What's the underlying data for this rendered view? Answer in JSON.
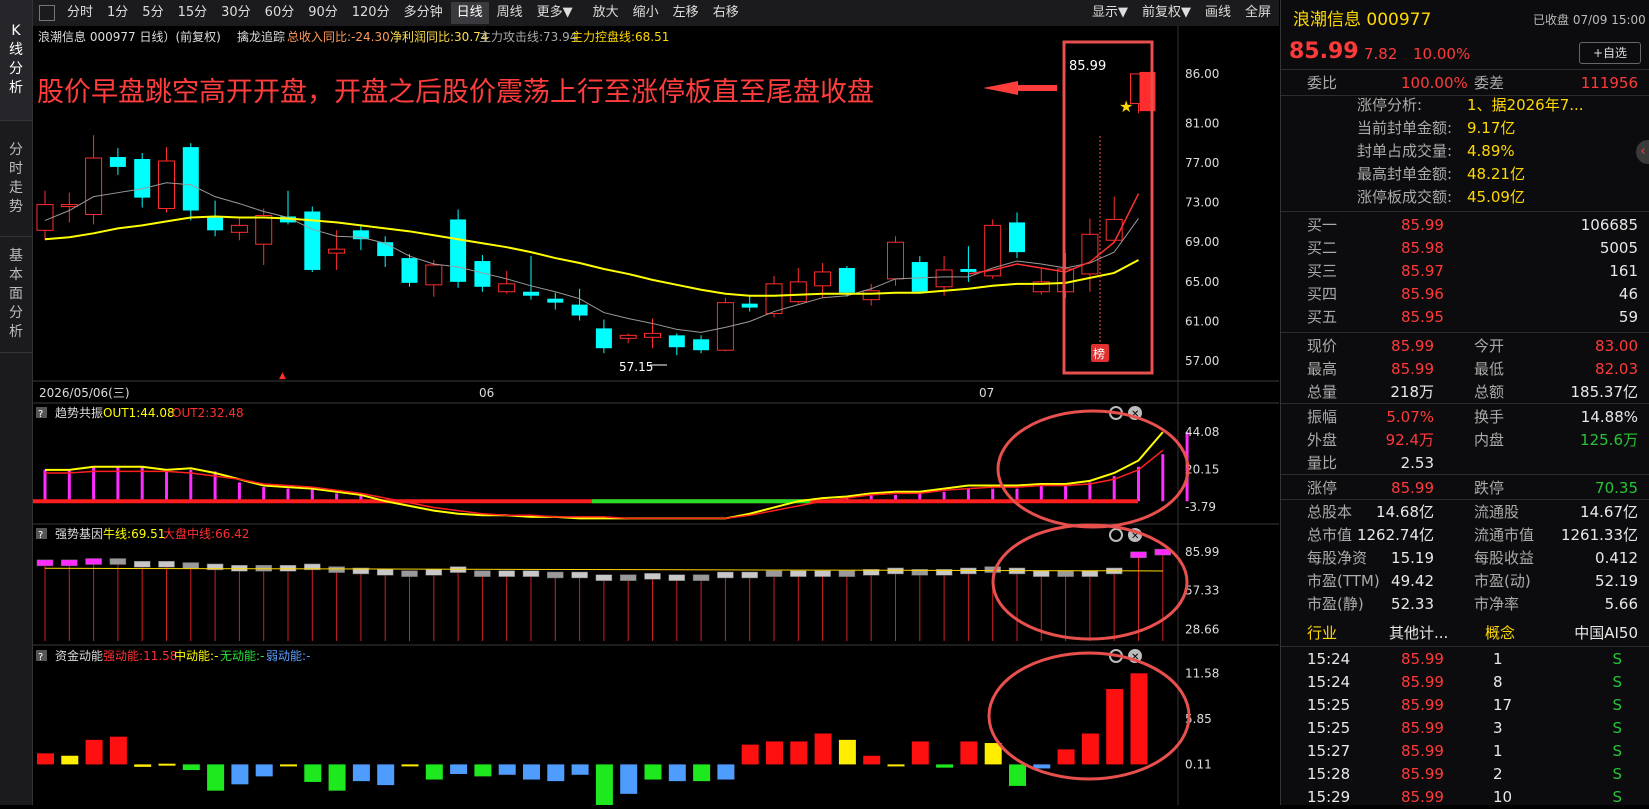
{
  "left_tabs": [
    "K线分析",
    "分时走势",
    "基本面分析"
  ],
  "toolbar": {
    "periods": [
      "分时",
      "1分",
      "5分",
      "15分",
      "30分",
      "60分",
      "90分",
      "120分",
      "多分钟",
      "日线",
      "周线",
      "更多▼"
    ],
    "active_period": "日线",
    "actions": [
      "放大",
      "缩小",
      "左移",
      "右移"
    ],
    "right": [
      "显示▼",
      "前复权▼",
      "画线",
      "全屏"
    ]
  },
  "chart_header": {
    "stock": "浪潮信息 000977 日线）(前复权)",
    "indicator": "擒龙追踪",
    "revenue": "总收入同比:-24.30",
    "profit": "净利润同比:30.74",
    "attack": "主力攻击线:73.94",
    "control": "主力控盘线:68.51"
  },
  "annotation": "股价早盘跳空高开开盘，开盘之后股价震荡上行至涨停板直至尾盘收盘",
  "price_label": "85.99",
  "low_label": "57.15",
  "bang_label": "榜",
  "date_axis": [
    "2026/05/06(三)",
    "06",
    "07"
  ],
  "colors": {
    "up": "#ff2d2d",
    "down": "#00ffff",
    "ma_yellow": "#ffff00",
    "ma_gray": "#9a9a9a",
    "ma_red": "#ff3030",
    "annot_red": "#ff3d3d",
    "ring": "#e8504d"
  },
  "chart_data": [
    {
      "type": "candlestick",
      "title": "浪潮信息 000977 日线",
      "ylim": [
        56.0,
        88.0
      ],
      "y_ticks": [
        86.0,
        81.0,
        77.0,
        73.0,
        69.0,
        65.0,
        61.0,
        57.0
      ],
      "candles": [
        {
          "o": 70.2,
          "c": 72.8,
          "h": 74.2,
          "l": 69.2
        },
        {
          "o": 72.6,
          "c": 72.8,
          "h": 74.0,
          "l": 71.0
        },
        {
          "o": 71.8,
          "c": 77.5,
          "h": 79.8,
          "l": 70.8
        },
        {
          "o": 77.6,
          "c": 76.6,
          "h": 78.5,
          "l": 75.8
        },
        {
          "o": 77.4,
          "c": 73.5,
          "h": 78.0,
          "l": 72.5
        },
        {
          "o": 72.4,
          "c": 77.2,
          "h": 78.6,
          "l": 72.0
        },
        {
          "o": 78.6,
          "c": 72.2,
          "h": 79.0,
          "l": 71.2
        },
        {
          "o": 71.6,
          "c": 70.2,
          "h": 73.2,
          "l": 69.6
        },
        {
          "o": 70.0,
          "c": 70.7,
          "h": 71.6,
          "l": 69.2
        },
        {
          "o": 68.8,
          "c": 71.7,
          "h": 72.4,
          "l": 66.7
        },
        {
          "o": 71.6,
          "c": 71.0,
          "h": 74.2,
          "l": 70.8
        },
        {
          "o": 72.1,
          "c": 66.2,
          "h": 72.6,
          "l": 66.0
        },
        {
          "o": 67.9,
          "c": 68.3,
          "h": 70.2,
          "l": 66.2
        },
        {
          "o": 70.2,
          "c": 69.3,
          "h": 70.8,
          "l": 68.2
        },
        {
          "o": 69.0,
          "c": 67.6,
          "h": 69.6,
          "l": 66.5
        },
        {
          "o": 67.4,
          "c": 64.9,
          "h": 67.8,
          "l": 64.5
        },
        {
          "o": 64.7,
          "c": 66.7,
          "h": 67.2,
          "l": 63.5
        },
        {
          "o": 71.3,
          "c": 65.0,
          "h": 72.3,
          "l": 64.4
        },
        {
          "o": 67.1,
          "c": 64.5,
          "h": 67.7,
          "l": 64.0
        },
        {
          "o": 64.0,
          "c": 64.8,
          "h": 66.1,
          "l": 63.8
        },
        {
          "o": 64.0,
          "c": 63.6,
          "h": 67.6,
          "l": 63.2
        },
        {
          "o": 63.3,
          "c": 62.9,
          "h": 63.9,
          "l": 62.2
        },
        {
          "o": 62.7,
          "c": 61.6,
          "h": 64.3,
          "l": 61.1
        },
        {
          "o": 60.3,
          "c": 58.3,
          "h": 61.2,
          "l": 57.8
        },
        {
          "o": 59.3,
          "c": 59.6,
          "h": 59.8,
          "l": 58.8
        },
        {
          "o": 59.4,
          "c": 59.8,
          "h": 61.3,
          "l": 58.3
        },
        {
          "o": 59.6,
          "c": 58.4,
          "h": 59.8,
          "l": 57.6
        },
        {
          "o": 59.2,
          "c": 58.1,
          "h": 59.6,
          "l": 57.8
        },
        {
          "o": 58.1,
          "c": 62.9,
          "h": 63.4,
          "l": 58.0
        },
        {
          "o": 62.8,
          "c": 62.4,
          "h": 63.6,
          "l": 62.0
        },
        {
          "o": 61.8,
          "c": 64.8,
          "h": 65.6,
          "l": 61.4
        },
        {
          "o": 63.0,
          "c": 65.0,
          "h": 66.4,
          "l": 62.8
        },
        {
          "o": 64.6,
          "c": 66.0,
          "h": 66.9,
          "l": 63.4
        },
        {
          "o": 66.4,
          "c": 63.9,
          "h": 66.6,
          "l": 63.5
        },
        {
          "o": 63.2,
          "c": 64.1,
          "h": 64.8,
          "l": 62.6
        },
        {
          "o": 65.3,
          "c": 69.0,
          "h": 69.6,
          "l": 64.6
        },
        {
          "o": 67.0,
          "c": 64.0,
          "h": 67.6,
          "l": 63.8
        },
        {
          "o": 64.5,
          "c": 66.2,
          "h": 67.6,
          "l": 63.6
        },
        {
          "o": 66.3,
          "c": 66.0,
          "h": 68.6,
          "l": 65.0
        },
        {
          "o": 65.6,
          "c": 70.7,
          "h": 71.3,
          "l": 65.3
        },
        {
          "o": 71.0,
          "c": 68.0,
          "h": 72.0,
          "l": 67.4
        },
        {
          "o": 64.0,
          "c": 65.0,
          "h": 66.3,
          "l": 63.7
        },
        {
          "o": 64.0,
          "c": 66.3,
          "h": 67.9,
          "l": 63.4
        },
        {
          "o": 65.8,
          "c": 69.8,
          "h": 71.4,
          "l": 64.0
        },
        {
          "o": 69.2,
          "c": 71.3,
          "h": 73.6,
          "l": 69.0
        },
        {
          "o": 83.0,
          "c": 85.99,
          "h": 85.99,
          "l": 82.03
        }
      ],
      "ma_gray": [
        71.2,
        72.2,
        73.6,
        74.0,
        74.4,
        75.0,
        74.8,
        73.6,
        72.9,
        72.1,
        71.5,
        70.3,
        69.6,
        69.5,
        68.9,
        67.6,
        66.8,
        66.5,
        65.9,
        65.3,
        64.6,
        64.0,
        63.3,
        61.9,
        61.3,
        60.8,
        60.2,
        59.9,
        60.4,
        61.0,
        62.0,
        62.7,
        63.4,
        63.6,
        64.3,
        65.3,
        65.4,
        65.5,
        65.5,
        66.4,
        67.1,
        66.8,
        66.4,
        66.9,
        68.0,
        71.4
      ],
      "ma_yellow": [
        69.3,
        69.5,
        69.9,
        70.4,
        70.7,
        71.1,
        71.5,
        71.6,
        71.5,
        71.5,
        71.4,
        71.2,
        71.0,
        70.7,
        70.4,
        70.1,
        69.7,
        69.3,
        68.9,
        68.5,
        68.0,
        67.4,
        66.9,
        66.3,
        65.8,
        65.2,
        64.7,
        64.2,
        63.8,
        63.6,
        63.6,
        63.7,
        63.8,
        63.8,
        63.8,
        63.9,
        63.9,
        64.1,
        64.3,
        64.6,
        64.8,
        64.8,
        64.9,
        65.4,
        65.9,
        67.2
      ],
      "ma_red": [
        null,
        null,
        null,
        null,
        null,
        null,
        null,
        null,
        null,
        null,
        null,
        null,
        null,
        null,
        null,
        null,
        null,
        null,
        null,
        null,
        null,
        null,
        null,
        null,
        null,
        null,
        null,
        null,
        null,
        null,
        null,
        null,
        null,
        null,
        null,
        null,
        null,
        null,
        65.8,
        66.2,
        66.8,
        66.4,
        66.0,
        67.0,
        69.0,
        73.9
      ]
    },
    {
      "type": "bar",
      "title": "趋势共振",
      "series": [
        {
          "name": "OUT1",
          "last": "44.08"
        },
        {
          "name": "OUT2",
          "last": "32.48"
        }
      ],
      "y_ticks": [
        44.08,
        20.15,
        -3.79
      ],
      "ylim": [
        -12.0,
        48.0
      ],
      "bars": [
        20,
        20,
        22,
        22,
        22,
        20,
        20,
        19,
        12,
        9,
        8,
        9,
        5,
        4,
        0,
        0,
        0,
        0,
        0,
        0,
        0,
        0,
        0,
        0,
        0,
        0,
        0,
        0,
        0,
        0,
        0,
        0,
        0,
        3,
        4,
        4,
        5,
        6,
        8,
        8,
        8,
        10,
        10,
        12,
        16,
        22,
        30,
        44.08
      ],
      "out1": [
        20,
        20,
        22,
        22,
        22,
        20,
        21,
        18,
        14,
        10,
        9,
        8,
        6,
        4,
        0,
        -3,
        -6,
        -8,
        -9,
        -9,
        -10,
        -10,
        -11,
        -11,
        -11,
        -11,
        -11,
        -11,
        -11,
        -8,
        -4,
        0,
        2,
        3,
        5,
        6,
        6,
        8,
        10,
        10,
        10,
        11,
        11,
        13,
        18,
        26,
        44.08
      ],
      "out2": [
        18,
        18,
        19,
        19,
        19,
        19,
        18,
        16,
        14,
        11,
        10,
        9,
        7,
        5,
        2,
        -1,
        -4,
        -6,
        -8,
        -9,
        -9,
        -10,
        -10,
        -10,
        -11,
        -11,
        -11,
        -11,
        -11,
        -9,
        -6,
        -3,
        0,
        2,
        4,
        5,
        5,
        7,
        8,
        9,
        9,
        10,
        10,
        11,
        14,
        20,
        32.48
      ],
      "trend_line": {
        "value": 0,
        "green_from": 23,
        "green_to": 31
      }
    },
    {
      "type": "bar",
      "title": "强势基因",
      "series": [
        {
          "name": "牛线",
          "last": "69.51"
        },
        {
          "name": "大盘中线",
          "last": "66.42"
        }
      ],
      "y_ticks": [
        85.99,
        57.33,
        28.66
      ],
      "ylim": [
        20.0,
        92.0
      ],
      "bars": [
        78,
        78,
        79,
        79,
        77,
        77,
        76,
        75,
        74,
        74,
        74,
        75,
        73,
        72,
        71,
        70,
        71,
        73,
        70,
        70,
        70,
        69,
        69,
        67,
        67,
        68,
        67,
        67,
        69,
        69,
        70,
        70,
        70,
        70,
        71,
        72,
        71,
        71,
        72,
        73,
        72,
        70,
        70,
        70,
        72,
        84,
        86
      ],
      "bar_magenta": [
        0,
        1,
        2,
        45,
        46
      ]
    },
    {
      "type": "bar",
      "title": "资金动能",
      "series": [
        {
          "name": "强动能",
          "last": "11.58"
        },
        {
          "name": "中动能",
          "last": "-"
        },
        {
          "name": "无动能",
          "last": "-"
        },
        {
          "name": "弱动能",
          "last": "-"
        }
      ],
      "y_ticks": [
        11.58,
        5.85,
        0.11
      ],
      "ylim": [
        -4.5,
        12.5
      ],
      "values": [
        1.5,
        1.2,
        3.2,
        3.6,
        -0.2,
        0.2,
        -0.6,
        -3.2,
        -2.4,
        -1.4,
        0,
        -2.1,
        -3.2,
        -2.0,
        -2.5,
        0,
        -1.8,
        -1.1,
        -1.4,
        -1.2,
        -1.8,
        -2.0,
        -1.2,
        -5.0,
        -3.6,
        -1.8,
        -2.0,
        -2.0,
        -1.8,
        2.6,
        3.0,
        3.0,
        4.0,
        3.2,
        1.2,
        0,
        3.0,
        -0.3,
        3.0,
        2.8,
        -2.6,
        -0.4,
        2.0,
        4.0,
        9.6,
        11.58
      ],
      "colors": [
        "r",
        "y",
        "r",
        "r",
        "y",
        "y",
        "g",
        "g",
        "b",
        "b",
        "y",
        "g",
        "g",
        "b",
        "b",
        "y",
        "g",
        "b",
        "g",
        "b",
        "b",
        "b",
        "b",
        "g",
        "b",
        "g",
        "b",
        "g",
        "b",
        "r",
        "r",
        "r",
        "r",
        "y",
        "r",
        "y",
        "r",
        "g",
        "r",
        "y",
        "g",
        "b",
        "r",
        "r",
        "r",
        "r"
      ]
    }
  ],
  "right_panel": {
    "name": "浪潮信息 000977",
    "status": "已收盘 07/09 15:00",
    "price": "85.99",
    "change": "7.82",
    "pct": "10.00%",
    "watch_btn": "+自选",
    "weibi_label": "委比",
    "weibi": "100.00%",
    "weicha_label": "委差",
    "weicha": "111956",
    "limit_rows": [
      {
        "k": "涨停分析:",
        "v": "1、据2026年7..."
      },
      {
        "k": "当前封单金额:",
        "v": "9.17亿"
      },
      {
        "k": "封单占成交量:",
        "v": "4.89%"
      },
      {
        "k": "最高封单金额:",
        "v": "48.21亿"
      },
      {
        "k": "涨停板成交额:",
        "v": "45.09亿"
      }
    ],
    "bids": [
      {
        "k": "买一",
        "p": "85.99",
        "v": "106685"
      },
      {
        "k": "买二",
        "p": "85.98",
        "v": "5005"
      },
      {
        "k": "买三",
        "p": "85.97",
        "v": "161"
      },
      {
        "k": "买四",
        "p": "85.96",
        "v": "46"
      },
      {
        "k": "买五",
        "p": "85.95",
        "v": "59"
      }
    ],
    "quotes": [
      {
        "k1": "现价",
        "v1": "85.99",
        "c1": "red",
        "k2": "今开",
        "v2": "83.00",
        "c2": "red"
      },
      {
        "k1": "最高",
        "v1": "85.99",
        "c1": "red",
        "k2": "最低",
        "v2": "82.03",
        "c2": "red"
      },
      {
        "k1": "总量",
        "v1": "218万",
        "c1": "white",
        "k2": "总额",
        "v2": "185.37亿",
        "c2": "white"
      }
    ],
    "stats": [
      {
        "k1": "振幅",
        "v1": "5.07%",
        "c1": "red",
        "k2": "换手",
        "v2": "14.88%",
        "c2": "white"
      },
      {
        "k1": "外盘",
        "v1": "92.4万",
        "c1": "red",
        "k2": "内盘",
        "v2": "125.6万",
        "c2": "green"
      },
      {
        "k1": "量比",
        "v1": "2.53",
        "c1": "white",
        "k2": "",
        "v2": "",
        "c2": "white"
      }
    ],
    "limits": [
      {
        "k1": "涨停",
        "v1": "85.99",
        "c1": "red",
        "k2": "跌停",
        "v2": "70.35",
        "c2": "green"
      }
    ],
    "fundamentals": [
      {
        "k1": "总股本",
        "v1": "14.68亿",
        "k2": "流通股",
        "v2": "14.67亿"
      },
      {
        "k1": "总市值",
        "v1": "1262.74亿",
        "k2": "流通市值",
        "v2": "1261.33亿"
      },
      {
        "k1": "每股净资",
        "v1": "15.19",
        "k2": "每股收益",
        "v2": "0.412"
      },
      {
        "k1": "市盈(TTM)",
        "v1": "49.42",
        "k2": "市盈(动)",
        "v2": "52.19"
      },
      {
        "k1": "市盈(静)",
        "v1": "52.33",
        "k2": "市净率",
        "v2": "5.66"
      }
    ],
    "industry": {
      "k1": "行业",
      "v1": "其他计...",
      "k2": "概念",
      "v2": "中国AI50"
    },
    "ticks": [
      {
        "t": "15:24",
        "p": "85.99",
        "v": "1",
        "s": "S"
      },
      {
        "t": "15:24",
        "p": "85.99",
        "v": "8",
        "s": "S"
      },
      {
        "t": "15:25",
        "p": "85.99",
        "v": "17",
        "s": "S"
      },
      {
        "t": "15:25",
        "p": "85.99",
        "v": "3",
        "s": "S"
      },
      {
        "t": "15:27",
        "p": "85.99",
        "v": "1",
        "s": "S"
      },
      {
        "t": "15:28",
        "p": "85.99",
        "v": "2",
        "s": "S"
      },
      {
        "t": "15:29",
        "p": "85.99",
        "v": "10",
        "s": "S"
      }
    ]
  }
}
